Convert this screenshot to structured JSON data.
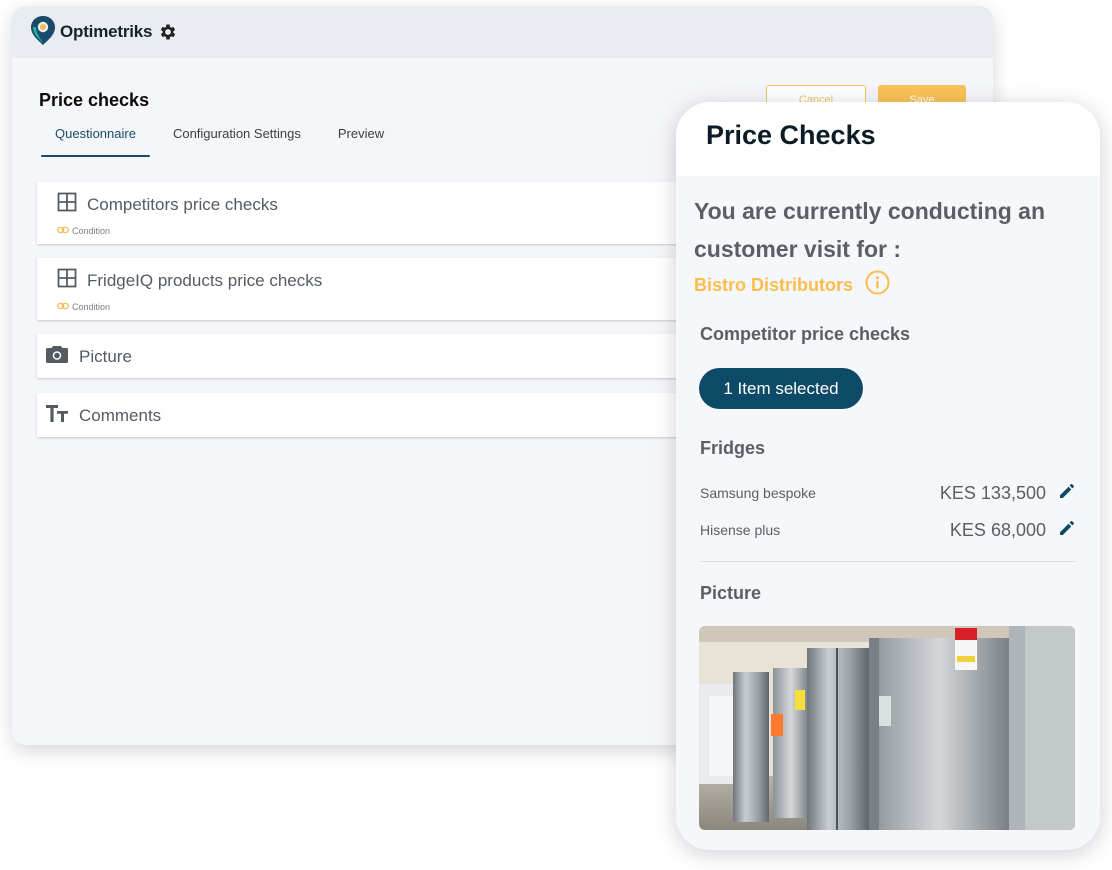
{
  "app": {
    "brand": "Optimetriks",
    "page_title": "Price checks",
    "tabs": [
      {
        "label": "Questionnaire"
      },
      {
        "label": "Configuration Settings"
      },
      {
        "label": "Preview"
      }
    ],
    "buttons": {
      "cancel": "Cancel",
      "save": "Save"
    },
    "questions": [
      {
        "title": "Competitors price checks",
        "tag": "Condition"
      },
      {
        "title": "FridgeIQ products price checks",
        "tag": "Condition"
      },
      {
        "title": "Picture"
      },
      {
        "title": "Comments"
      }
    ]
  },
  "phone": {
    "title": "Price Checks",
    "visit_message": "You are currently conducting an customer visit for :",
    "customer": "Bistro Distributors",
    "competitor_heading": "Competitor price checks",
    "selection_pill": "1 Item selected",
    "fridges_heading": "Fridges",
    "items": [
      {
        "name": "Samsung bespoke",
        "price": "KES 133,500"
      },
      {
        "name": "Hisense plus",
        "price": "KES 68,000"
      }
    ],
    "picture_heading": "Picture"
  },
  "colors": {
    "accent": "#fbbd4e",
    "primary": "#0d4a67",
    "tab_active": "#1a4b6a"
  }
}
